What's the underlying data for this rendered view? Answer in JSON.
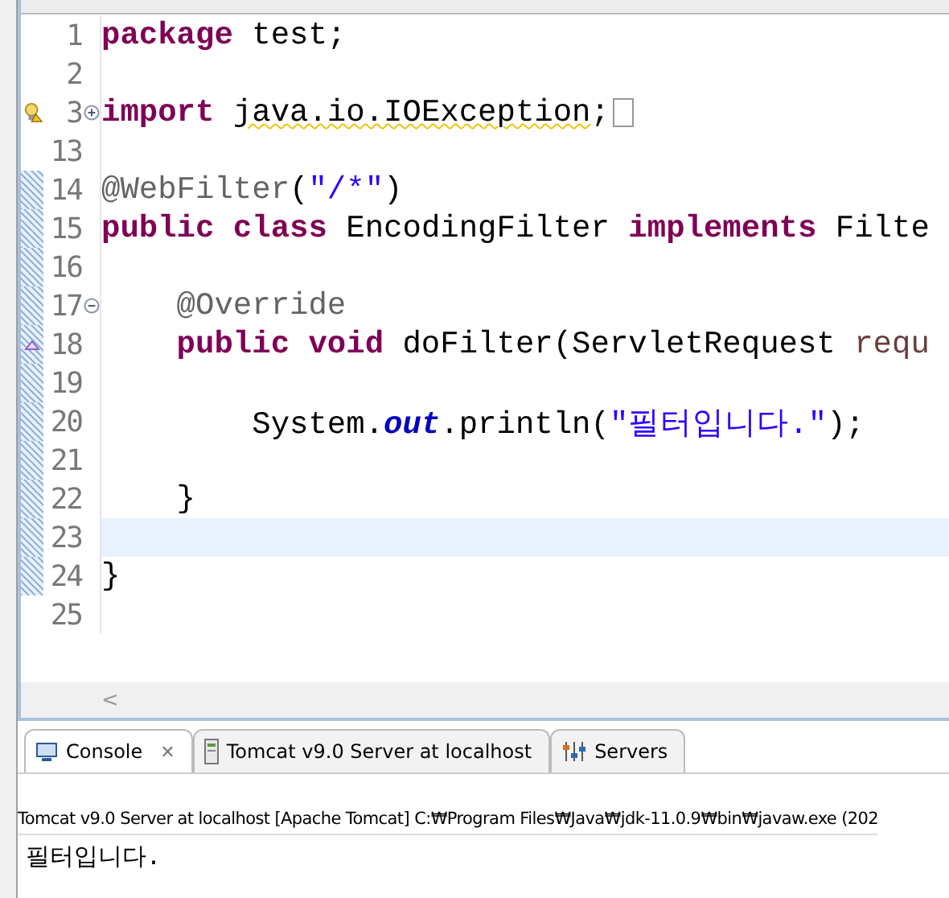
{
  "editor": {
    "lines": [
      {
        "number": "1",
        "current": false,
        "changed": false,
        "tokens": [
          {
            "kind": "keyword",
            "text": "package"
          },
          {
            "kind": "plain",
            "text": " test;"
          }
        ]
      },
      {
        "number": "2",
        "current": false,
        "changed": false
      },
      {
        "number": "3",
        "current": false,
        "changed": false,
        "warning": true,
        "fold": {
          "collapsed": true
        },
        "tokens": [
          {
            "kind": "keyword",
            "text": "import "
          },
          {
            "kind": "warning",
            "text": "java.io.IOException"
          },
          {
            "kind": "plain",
            "text": ";"
          }
        ]
      },
      {
        "number": "13",
        "current": false,
        "changed": false
      },
      {
        "number": "14",
        "current": false,
        "changed": true,
        "tokens": [
          {
            "kind": "annotation",
            "text": "@WebFilter"
          },
          {
            "kind": "plain",
            "text": "("
          },
          {
            "kind": "string",
            "text": "\"/*\""
          },
          {
            "kind": "plain",
            "text": ")"
          }
        ]
      },
      {
        "number": "15",
        "current": false,
        "changed": true,
        "tokens": [
          {
            "kind": "keyword",
            "text": "public class"
          },
          {
            "kind": "plain",
            "text": " EncodingFilter "
          },
          {
            "kind": "keyword",
            "text": "implements"
          },
          {
            "kind": "plain",
            "text": " Filte"
          }
        ]
      },
      {
        "number": "16",
        "current": false,
        "changed": true
      },
      {
        "number": "17",
        "current": false,
        "changed": true,
        "fold": {
          "collapsed": false
        },
        "tokens": [
          {
            "kind": "annotation",
            "text": "    @Override"
          }
        ]
      },
      {
        "number": "18",
        "current": false,
        "changed": true,
        "overrides": true,
        "tokens": [
          {
            "kind": "keyword",
            "text": "    public void"
          },
          {
            "kind": "plain",
            "text": " doFilter(ServletRequest "
          },
          {
            "kind": "param",
            "text": "requ"
          }
        ]
      },
      {
        "number": "19",
        "current": false,
        "changed": true
      },
      {
        "number": "20",
        "current": false,
        "changed": true,
        "tokens": [
          {
            "kind": "plain",
            "text": "        System."
          },
          {
            "kind": "field",
            "text": "out"
          },
          {
            "kind": "plain",
            "text": ".println("
          },
          {
            "kind": "string",
            "text": "\"필터입니다.\""
          },
          {
            "kind": "plain",
            "text": ");"
          }
        ]
      },
      {
        "number": "21",
        "current": false,
        "changed": true
      },
      {
        "number": "22",
        "current": false,
        "changed": true,
        "tokens": [
          {
            "kind": "plain",
            "text": "    }"
          }
        ]
      },
      {
        "number": "23",
        "current": true,
        "changed": true
      },
      {
        "number": "24",
        "current": false,
        "changed": true,
        "tokens": [
          {
            "kind": "plain",
            "text": "}"
          }
        ]
      },
      {
        "number": "25",
        "current": false,
        "changed": false
      }
    ],
    "scroll_left": "<"
  },
  "console": {
    "tabs": [
      {
        "label": "Console",
        "kind": "console",
        "selected": true,
        "close": "✕"
      },
      {
        "label": "Tomcat v9.0 Server at localhost",
        "kind": "server",
        "selected": false
      },
      {
        "label": "Servers",
        "kind": "servers",
        "selected": false
      }
    ],
    "header": "Tomcat v9.0 Server at localhost [Apache Tomcat] C:₩Program Files₩Java₩jdk-11.0.9₩bin₩javaw.exe  (202",
    "output": "필터입니다."
  }
}
